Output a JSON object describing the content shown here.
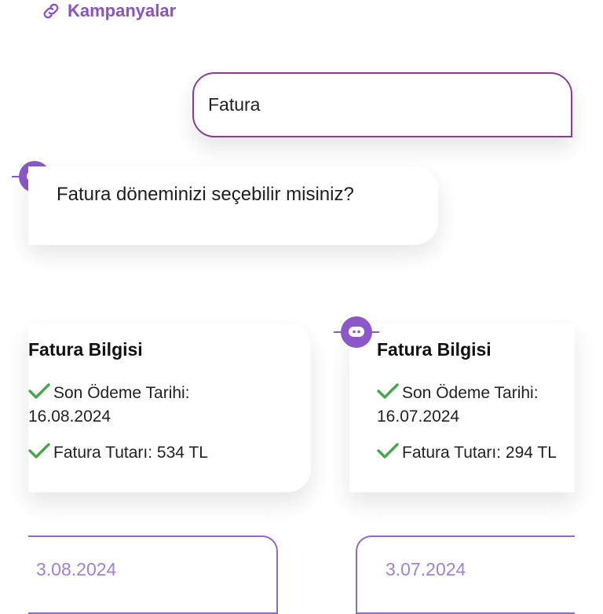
{
  "header": {
    "link_label": "Kampanyalar",
    "link_icon": "link-icon"
  },
  "user_message": {
    "text": "Fatura"
  },
  "bot_message": {
    "text": "Fatura döneminizi seçebilir misiniz?"
  },
  "invoice_cards": [
    {
      "title": "Fatura Bilgisi",
      "due_label": "Son Ödeme Tarihi:",
      "due_date": "16.08.2024",
      "amount": "Fatura Tutarı: 534 TL"
    },
    {
      "title": "Fatura Bilgisi",
      "due_label": "Son Ödeme Tarihi:",
      "due_date": "16.07.2024",
      "amount": "Fatura Tutarı: 294 TL"
    }
  ],
  "period_options": [
    "3.08.2024",
    "3.07.2024"
  ],
  "colors": {
    "accent": "#8c58c9",
    "user_border": "#8b3e8e",
    "check": "#46a84a",
    "date_text": "#9f82d2"
  }
}
